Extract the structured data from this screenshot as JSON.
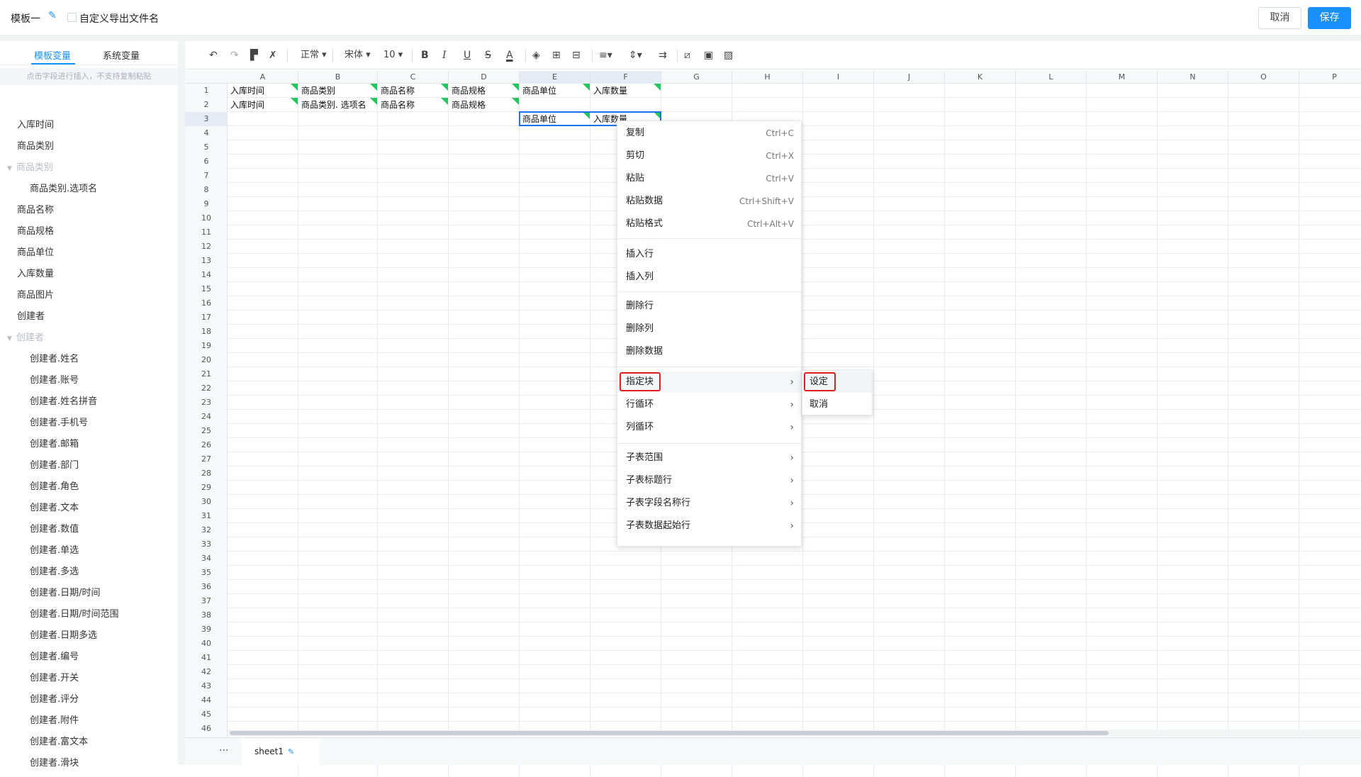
{
  "header": {
    "template_name": "模板一",
    "custom_export_label": "自定义导出文件名",
    "cancel_label": "取消",
    "save_label": "保存"
  },
  "sidebar": {
    "tabs": [
      "模板变量",
      "系统变量"
    ],
    "hint": "点击字段进行插入，不支持复制粘贴",
    "items": [
      {
        "label": "入库时间",
        "type": "item"
      },
      {
        "label": "商品类别",
        "type": "item"
      },
      {
        "label": "商品类别",
        "type": "group"
      },
      {
        "label": "商品类别.选项名",
        "type": "sub"
      },
      {
        "label": "商品名称",
        "type": "item"
      },
      {
        "label": "商品规格",
        "type": "item"
      },
      {
        "label": "商品单位",
        "type": "item"
      },
      {
        "label": "入库数量",
        "type": "item"
      },
      {
        "label": "商品图片",
        "type": "item"
      },
      {
        "label": "创建者",
        "type": "item"
      },
      {
        "label": "创建者",
        "type": "group"
      },
      {
        "label": "创建者.姓名",
        "type": "sub"
      },
      {
        "label": "创建者.账号",
        "type": "sub"
      },
      {
        "label": "创建者.姓名拼音",
        "type": "sub"
      },
      {
        "label": "创建者.手机号",
        "type": "sub"
      },
      {
        "label": "创建者.邮箱",
        "type": "sub"
      },
      {
        "label": "创建者.部门",
        "type": "sub"
      },
      {
        "label": "创建者.角色",
        "type": "sub"
      },
      {
        "label": "创建者.文本",
        "type": "sub"
      },
      {
        "label": "创建者.数值",
        "type": "sub"
      },
      {
        "label": "创建者.单选",
        "type": "sub"
      },
      {
        "label": "创建者.多选",
        "type": "sub"
      },
      {
        "label": "创建者.日期/时间",
        "type": "sub"
      },
      {
        "label": "创建者.日期/时间范围",
        "type": "sub"
      },
      {
        "label": "创建者.日期多选",
        "type": "sub"
      },
      {
        "label": "创建者.编号",
        "type": "sub"
      },
      {
        "label": "创建者.开关",
        "type": "sub"
      },
      {
        "label": "创建者.评分",
        "type": "sub"
      },
      {
        "label": "创建者.附件",
        "type": "sub"
      },
      {
        "label": "创建者.富文本",
        "type": "sub"
      },
      {
        "label": "创建者.滑块",
        "type": "sub"
      }
    ]
  },
  "toolbar": {
    "format_label": "正常",
    "font_label": "宋体",
    "size_label": "10"
  },
  "columns": [
    "A",
    "B",
    "C",
    "D",
    "E",
    "F",
    "G",
    "H",
    "I",
    "J",
    "K",
    "L",
    "M",
    "N",
    "O",
    "P"
  ],
  "rows": [
    "1",
    "2",
    "3",
    "4",
    "5",
    "6",
    "7",
    "8",
    "9",
    "10",
    "11",
    "12",
    "13",
    "14",
    "15",
    "16",
    "17",
    "18",
    "19",
    "20",
    "21",
    "22",
    "23",
    "24",
    "25",
    "26",
    "27",
    "28",
    "29",
    "30",
    "31",
    "32",
    "33",
    "34",
    "35",
    "36",
    "37",
    "38",
    "39",
    "40",
    "41",
    "42",
    "43",
    "44",
    "45",
    "46"
  ],
  "cells": [
    {
      "r": 0,
      "c": 0,
      "text": "入库时间"
    },
    {
      "r": 0,
      "c": 1,
      "text": "商品类别"
    },
    {
      "r": 0,
      "c": 2,
      "text": "商品名称"
    },
    {
      "r": 0,
      "c": 3,
      "text": "商品规格"
    },
    {
      "r": 0,
      "c": 4,
      "text": "商品单位"
    },
    {
      "r": 0,
      "c": 5,
      "text": "入库数量"
    },
    {
      "r": 1,
      "c": 0,
      "text": "入库时间"
    },
    {
      "r": 1,
      "c": 1,
      "text": "商品类别. 选项名"
    },
    {
      "r": 1,
      "c": 2,
      "text": "商品名称"
    },
    {
      "r": 1,
      "c": 3,
      "text": "商品规格"
    },
    {
      "r": 2,
      "c": 4,
      "text": "商品单位"
    },
    {
      "r": 2,
      "c": 5,
      "text": "入库数量"
    }
  ],
  "context_menu": {
    "copy": {
      "label": "复制",
      "shortcut": "Ctrl+C"
    },
    "cut": {
      "label": "剪切",
      "shortcut": "Ctrl+X"
    },
    "paste": {
      "label": "粘贴",
      "shortcut": "Ctrl+V"
    },
    "paste_data": {
      "label": "粘贴数据",
      "shortcut": "Ctrl+Shift+V"
    },
    "paste_format": {
      "label": "粘贴格式",
      "shortcut": "Ctrl+Alt+V"
    },
    "insert_row": "插入行",
    "insert_col": "插入列",
    "delete_row": "删除行",
    "delete_col": "删除列",
    "delete_data": "删除数据",
    "assign_block": "指定块",
    "row_loop": "行循环",
    "col_loop": "列循环",
    "sub_range": "子表范围",
    "sub_title_row": "子表标题行",
    "sub_field_row": "子表字段名称行",
    "sub_data_row": "子表数据起始行"
  },
  "submenu": {
    "set": "设定",
    "cancel": "取消"
  },
  "sheet_tab": {
    "label": "sheet1"
  }
}
